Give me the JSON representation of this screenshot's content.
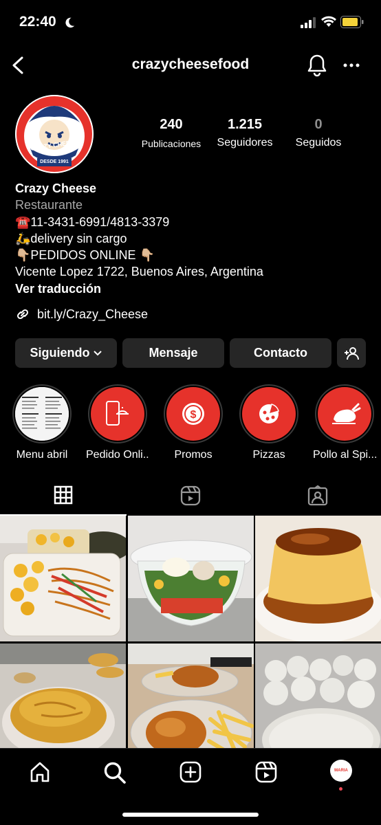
{
  "status": {
    "time": "22:40"
  },
  "nav": {
    "username": "crazycheesefood"
  },
  "avatar": {
    "brand": "CRAZY CHEESE",
    "since": "DESDE 1991"
  },
  "stats": [
    {
      "count": "240",
      "label": "Publicaciones"
    },
    {
      "count": "1.215",
      "label": "Seguidores"
    },
    {
      "count": "0",
      "label": "Seguidos"
    }
  ],
  "bio": {
    "name": "Crazy Cheese",
    "category": "Restaurante",
    "phone": "☎️11-3431-6991/4813-3379",
    "delivery": "🛵delivery sin cargo",
    "online": "👇🏼PEDIDOS ONLINE 👇🏼",
    "address": "Vicente Lopez 1722, Buenos Aires, Argentina",
    "translate": "Ver traducción",
    "link": "bit.ly/Crazy_Cheese"
  },
  "buttons": {
    "following": "Siguiendo",
    "message": "Mensaje",
    "contact": "Contacto"
  },
  "highlights": [
    {
      "label": "Menu abril"
    },
    {
      "label": "Pedido Onli..."
    },
    {
      "label": "Promos"
    },
    {
      "label": "Pizzas"
    },
    {
      "label": "Pollo al Spi..."
    }
  ],
  "bottom": {
    "avatar_text": "MARIA"
  },
  "colors": {
    "accent": "#e6322b",
    "button": "#262626",
    "muted": "#8e8e8e",
    "notification": "#ed4956"
  }
}
